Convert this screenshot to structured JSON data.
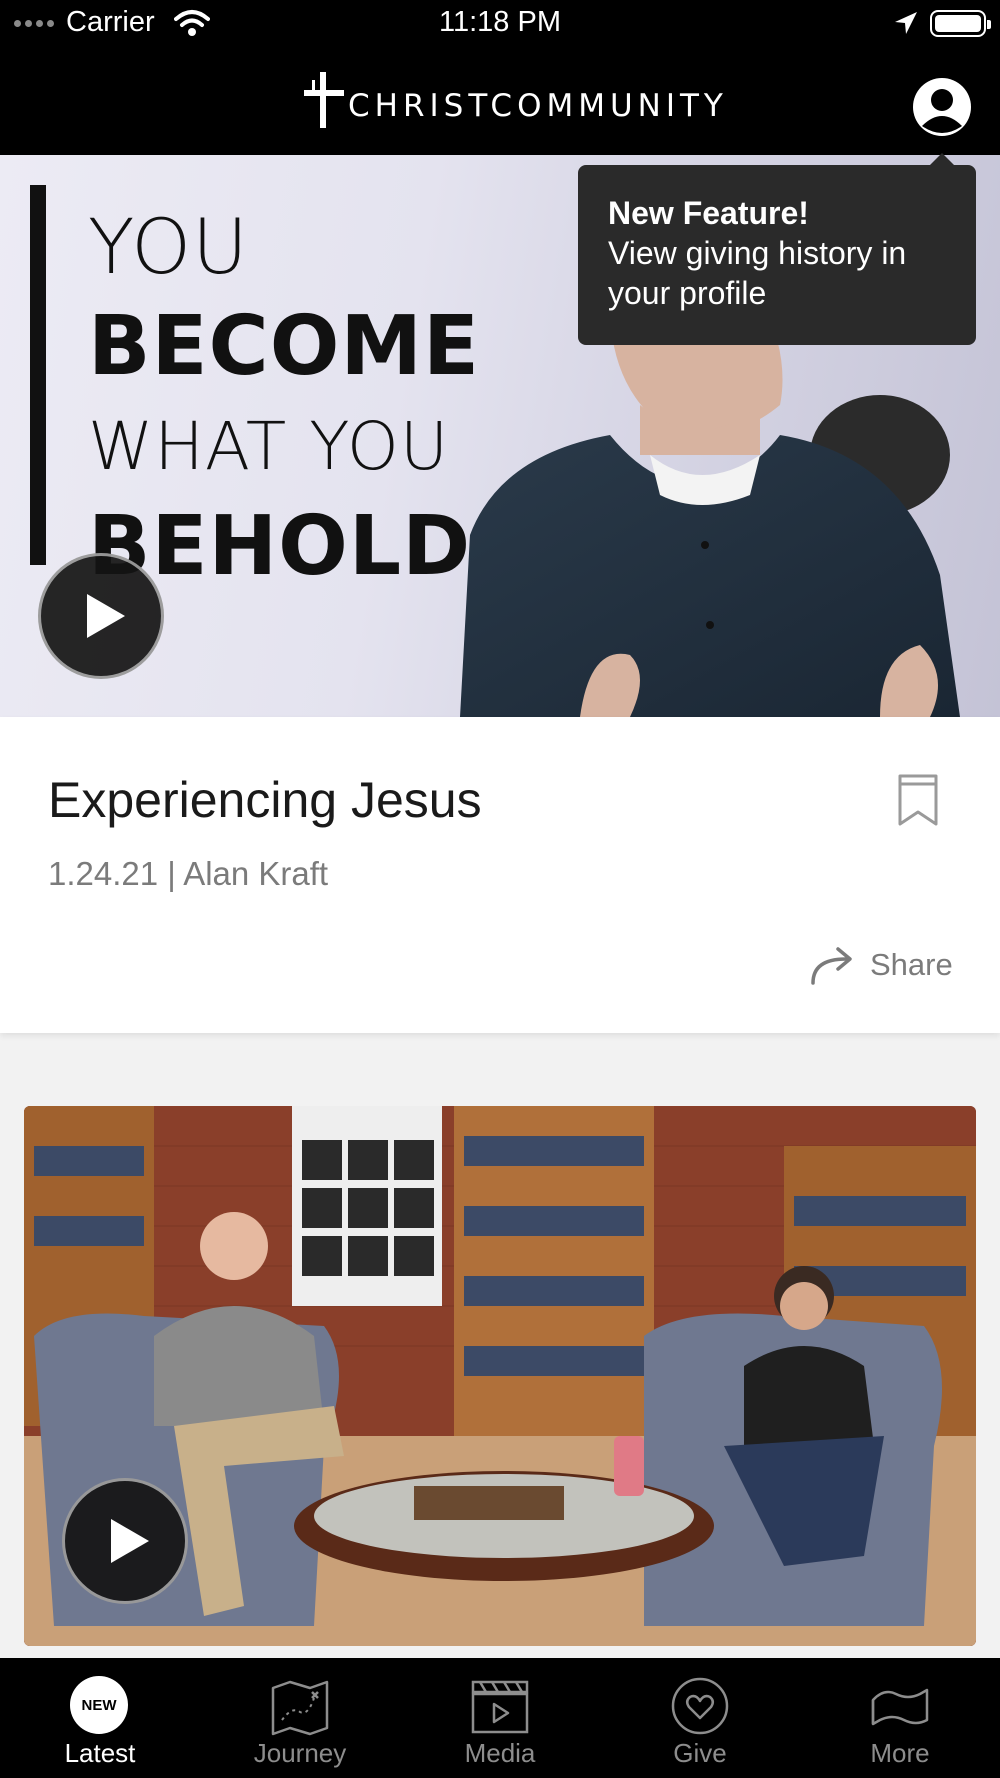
{
  "status_bar": {
    "carrier": "Carrier",
    "time": "11:18 PM"
  },
  "header": {
    "logo_text": "CHRISTCOMMUNITY"
  },
  "hero": {
    "line1": "YOU",
    "line2": "BECOME",
    "line3": "WHAT YOU",
    "line4": "BEHOLD"
  },
  "tooltip": {
    "title": "New Feature!",
    "body": "View giving history in your profile"
  },
  "sermon": {
    "title": "Experiencing Jesus",
    "meta": "1.24.21 | Alan Kraft",
    "share_label": "Share"
  },
  "tabs": [
    {
      "label": "Latest",
      "icon": "new-badge-icon",
      "badge": "NEW"
    },
    {
      "label": "Journey",
      "icon": "map-icon"
    },
    {
      "label": "Media",
      "icon": "video-icon"
    },
    {
      "label": "Give",
      "icon": "heart-icon"
    },
    {
      "label": "More",
      "icon": "more-icon"
    }
  ],
  "colors": {
    "header_bg": "#000000",
    "tooltip_bg": "#2a2a2a",
    "active_tab": "#ffffff",
    "inactive_tab": "#8d8d8d",
    "meta_text": "#7b7b7b"
  }
}
